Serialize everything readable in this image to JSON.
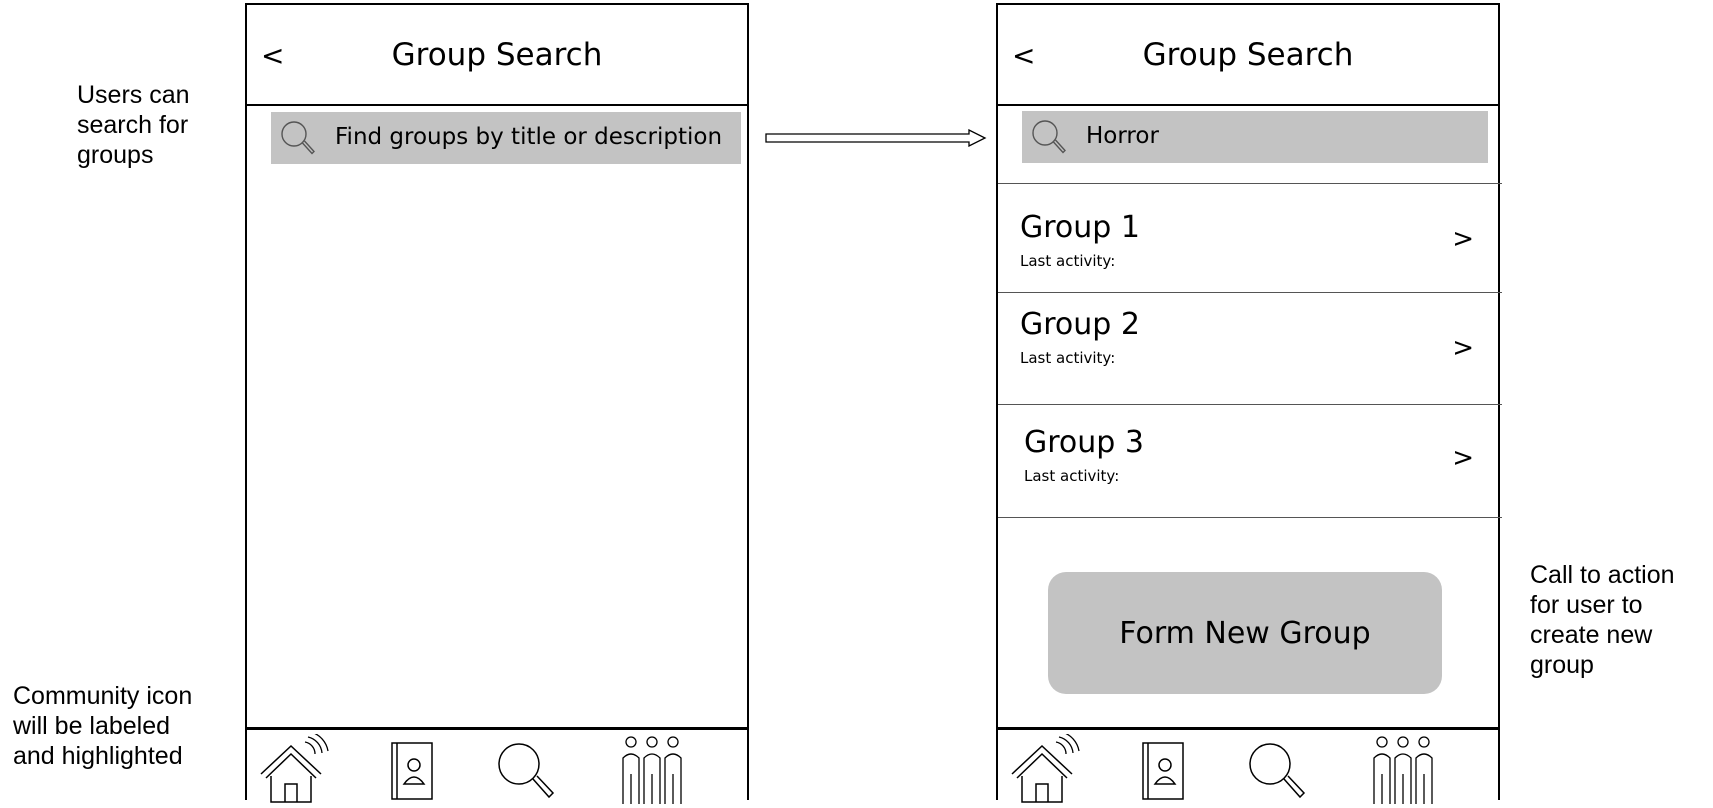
{
  "annotations": {
    "search_note": [
      "Users can",
      "search for",
      "groups"
    ],
    "community_note": [
      "Community icon",
      "will be labeled",
      "and highlighted"
    ],
    "cta_note": [
      "Call to action",
      "for user to",
      "create new",
      "group"
    ]
  },
  "screen_empty": {
    "back_label": "<",
    "title": "Group Search",
    "search_placeholder": "Find groups by title or description"
  },
  "screen_results": {
    "back_label": "<",
    "title": "Group Search",
    "search_value": "Horror",
    "results": [
      {
        "title": "Group 1",
        "subtitle": "Last activity:",
        "chevron": ">"
      },
      {
        "title": "Group 2",
        "subtitle": "Last activity:",
        "chevron": ">"
      },
      {
        "title": "Group 3",
        "subtitle": "Last activity:",
        "chevron": ">"
      }
    ],
    "cta_label": "Form New Group"
  },
  "bottom_nav": {
    "items": [
      {
        "icon": "home-icon"
      },
      {
        "icon": "contacts-icon"
      },
      {
        "icon": "search-icon"
      },
      {
        "icon": "community-icon"
      }
    ]
  },
  "colors": {
    "search_bar": "#c3c3c3",
    "cta_button": "#c3c3c3"
  }
}
